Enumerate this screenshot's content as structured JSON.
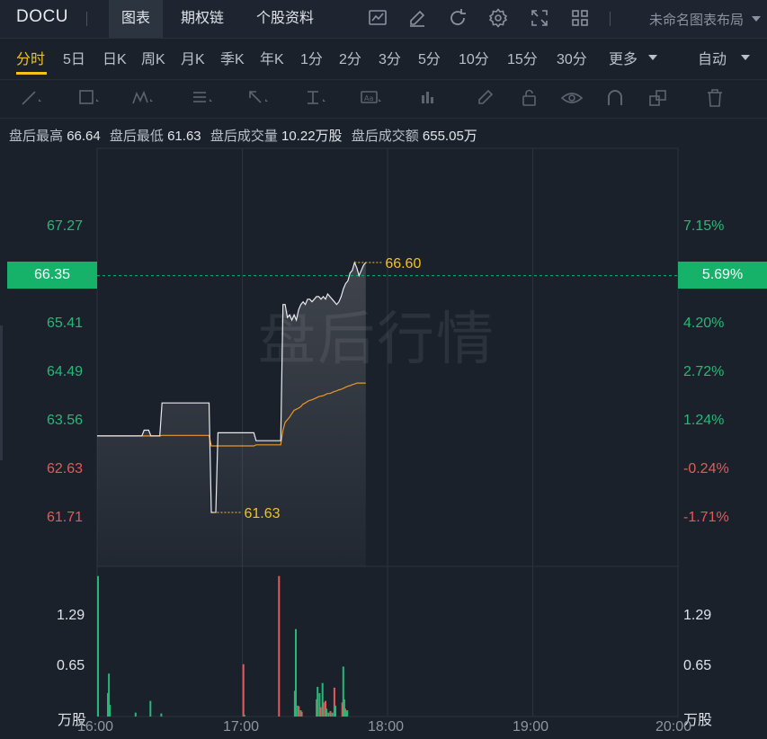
{
  "header": {
    "symbol": "DOCU",
    "tabs": [
      "图表",
      "期权链",
      "个股资料"
    ],
    "layout_name": "未命名图表布局",
    "icons": [
      "chart-indicator-icon",
      "draw-icon",
      "refresh-icon",
      "settings-icon",
      "fullscreen-icon",
      "grid-layout-icon"
    ]
  },
  "periods": [
    "分时",
    "5日",
    "日K",
    "周K",
    "月K",
    "季K",
    "年K",
    "1分",
    "2分",
    "3分",
    "5分",
    "10分",
    "15分",
    "30分",
    "更多"
  ],
  "period_mode": "自动",
  "tools": [
    "line-tool-icon",
    "rect-tool-icon",
    "pattern-tool-icon",
    "fib-tool-icon",
    "arrow-tool-icon",
    "measure-tool-icon",
    "text-tool-icon",
    "bar-tool-icon",
    "brush-icon",
    "lock-icon",
    "eye-icon",
    "magnet-icon",
    "layers-icon",
    "trash-icon"
  ],
  "stats": [
    {
      "label": "盘后最高",
      "value": "66.64"
    },
    {
      "label": "盘后最低",
      "value": "61.63"
    },
    {
      "label": "盘后成交量",
      "value": "10.22万股"
    },
    {
      "label": "盘后成交额",
      "value": "655.05万"
    }
  ],
  "watermark": "盘后行情",
  "colors": {
    "up": "#26b877",
    "down": "#e35a5a",
    "price_line": "#e8eaed",
    "avg_line": "#e8962e",
    "marker": "#f0c419",
    "badge": "#17b26a"
  },
  "chart_data": {
    "type": "line",
    "x_labels": [
      "16:00",
      "17:00",
      "18:00",
      "19:00",
      "20:00"
    ],
    "y_ticks": [
      "67.27",
      "65.41",
      "64.49",
      "63.56",
      "62.63",
      "61.71"
    ],
    "pct_ticks": [
      "7.15%",
      "4.20%",
      "2.72%",
      "1.24%",
      "-0.24%",
      "-1.71%"
    ],
    "current_price": "66.35",
    "current_pct": "5.69%",
    "high_marker": "66.60",
    "low_marker": "61.63",
    "volume_ticks": [
      "1.29",
      "0.65"
    ],
    "volume_unit": "万股",
    "price": [
      63.29,
      63.29,
      63.29,
      63.29,
      63.29,
      63.29,
      63.29,
      63.29,
      63.29,
      63.29,
      63.29,
      63.29,
      63.29,
      63.29,
      63.29,
      63.29,
      63.29,
      63.29,
      63.29,
      63.29,
      63.29,
      63.4,
      63.4,
      63.4,
      63.29,
      63.29,
      63.29,
      63.29,
      63.29,
      63.92,
      63.92,
      63.92,
      63.92,
      63.92,
      63.92,
      63.92,
      63.92,
      63.92,
      63.92,
      63.92,
      63.92,
      63.92,
      63.92,
      63.92,
      63.92,
      63.92,
      63.92,
      63.92,
      63.92,
      63.92,
      63.92,
      61.83,
      61.83,
      61.83,
      63.35,
      63.35,
      63.35,
      63.35,
      63.35,
      63.35,
      63.35,
      63.35,
      63.35,
      63.35,
      63.35,
      63.35,
      63.35,
      63.35,
      63.35,
      63.35,
      63.35,
      63.2,
      63.2,
      63.2,
      63.2,
      63.2,
      63.2,
      63.2,
      63.2,
      63.2,
      63.2,
      63.2,
      63.2,
      65.8,
      65.8,
      65.55,
      65.6,
      65.5,
      65.6,
      65.5,
      65.7,
      65.8,
      65.85,
      65.8,
      65.9,
      65.9,
      65.85,
      65.9,
      65.95,
      65.95,
      65.9,
      65.95,
      65.9,
      66.0,
      65.95,
      65.9,
      65.85,
      65.8,
      65.85,
      65.95,
      66.1,
      66.2,
      66.25,
      66.4,
      66.45,
      66.6,
      66.5,
      66.35,
      66.45,
      66.55,
      66.6
    ],
    "avg": [
      63.29,
      63.29,
      63.29,
      63.29,
      63.29,
      63.29,
      63.29,
      63.29,
      63.29,
      63.29,
      63.29,
      63.29,
      63.29,
      63.29,
      63.29,
      63.29,
      63.29,
      63.29,
      63.29,
      63.29,
      63.29,
      63.29,
      63.29,
      63.29,
      63.29,
      63.29,
      63.29,
      63.29,
      63.29,
      63.3,
      63.3,
      63.3,
      63.3,
      63.3,
      63.3,
      63.3,
      63.3,
      63.3,
      63.3,
      63.3,
      63.3,
      63.3,
      63.3,
      63.3,
      63.3,
      63.3,
      63.3,
      63.3,
      63.3,
      63.3,
      63.3,
      63.1,
      63.1,
      63.1,
      63.1,
      63.1,
      63.1,
      63.1,
      63.1,
      63.1,
      63.1,
      63.1,
      63.1,
      63.1,
      63.1,
      63.1,
      63.1,
      63.1,
      63.1,
      63.1,
      63.1,
      63.12,
      63.12,
      63.12,
      63.12,
      63.12,
      63.12,
      63.12,
      63.12,
      63.12,
      63.12,
      63.12,
      63.12,
      63.4,
      63.55,
      63.6,
      63.65,
      63.72,
      63.78,
      63.8,
      63.82,
      63.85,
      63.9,
      63.92,
      63.95,
      63.97,
      63.98,
      64.0,
      64.02,
      64.04,
      64.05,
      64.06,
      64.08,
      64.1,
      64.1,
      64.12,
      64.14,
      64.15,
      64.17,
      64.18,
      64.2,
      64.22,
      64.24,
      64.25,
      64.27,
      64.28,
      64.3,
      64.3,
      64.3,
      64.3,
      64.3
    ],
    "volume": [
      1.8,
      0,
      0,
      0,
      0,
      0,
      0,
      0,
      0,
      0,
      0,
      0.4,
      0.55,
      0.15,
      0,
      0,
      0,
      0,
      0,
      0,
      0,
      0,
      0,
      0,
      0,
      0,
      0,
      0,
      0,
      0,
      0,
      0,
      0,
      0,
      0,
      0,
      0,
      0,
      0.05,
      0,
      0,
      0,
      0,
      0,
      0,
      0,
      0,
      0,
      0,
      0.1,
      0.02,
      0.03,
      0.05,
      0,
      0,
      0,
      0,
      0,
      0,
      0,
      0,
      0,
      0,
      0,
      0,
      0,
      0,
      0,
      0,
      0.05,
      0.03,
      0.03,
      0,
      0,
      0,
      0,
      0,
      0,
      0,
      0,
      0,
      0,
      0,
      0.08,
      0.06,
      0.05,
      0,
      0,
      0,
      0.01,
      0.05,
      0.03,
      0.02,
      0.01,
      0.03,
      0.02,
      0,
      0,
      0.02,
      0.03,
      0.04,
      0,
      0.03,
      0.04,
      0.02,
      0.05,
      0.06,
      0.1,
      0.04,
      0.03,
      0.02,
      0.03,
      0.05,
      0.03,
      0.02,
      0.04,
      0.03,
      0.04
    ],
    "volume_up": [
      true,
      true,
      true,
      true,
      true,
      true,
      true,
      true,
      true,
      true,
      true,
      true,
      true,
      true,
      true,
      true,
      true,
      true,
      true,
      true,
      true,
      true,
      true,
      true,
      true,
      true,
      true,
      true,
      true,
      true,
      true,
      true,
      true,
      true,
      true,
      true,
      true,
      true,
      true,
      true,
      true,
      true,
      true,
      true,
      true,
      true,
      true,
      true,
      true,
      true,
      true,
      true,
      true,
      true,
      true,
      true,
      true,
      true,
      true,
      true,
      true,
      true,
      true,
      true,
      true,
      true,
      true,
      true,
      true,
      true,
      true,
      true,
      true,
      true,
      true,
      true,
      true,
      true,
      true,
      true,
      true,
      true,
      true,
      true,
      true,
      true,
      true,
      true,
      true,
      true,
      true,
      true,
      true,
      true,
      true,
      true,
      true,
      true,
      true,
      true,
      true,
      true,
      true,
      true,
      true,
      true,
      true,
      true,
      true,
      true,
      true,
      true,
      true,
      true,
      true,
      true,
      true,
      true,
      true,
      true,
      true,
      true,
      true,
      true
    ],
    "volume_bars": [
      {
        "t": 0,
        "v": 1.8,
        "up": true
      },
      {
        "t": 10,
        "v": 0.3,
        "up": true
      },
      {
        "t": 11,
        "v": 0.55,
        "up": true
      },
      {
        "t": 12,
        "v": 0.15,
        "up": true
      },
      {
        "t": 38,
        "v": 0.05,
        "up": true
      },
      {
        "t": 53,
        "v": 0.2,
        "up": true
      },
      {
        "t": 64,
        "v": 0.04,
        "up": true
      },
      {
        "t": 147,
        "v": 0.67,
        "up": false
      },
      {
        "t": 148,
        "v": 0.02,
        "up": true
      },
      {
        "t": 183,
        "v": 1.8,
        "up": false
      },
      {
        "t": 199,
        "v": 0.33,
        "up": true
      },
      {
        "t": 200,
        "v": 1.12,
        "up": true
      },
      {
        "t": 202,
        "v": 0.14,
        "up": true
      },
      {
        "t": 203,
        "v": 0.13,
        "up": false
      },
      {
        "t": 205,
        "v": 0.08,
        "up": true
      },
      {
        "t": 206,
        "v": 0.06,
        "up": false
      },
      {
        "t": 221,
        "v": 0.22,
        "up": false
      },
      {
        "t": 222,
        "v": 0.38,
        "up": true
      },
      {
        "t": 224,
        "v": 0.3,
        "up": true
      },
      {
        "t": 225,
        "v": 0.12,
        "up": false
      },
      {
        "t": 227,
        "v": 0.43,
        "up": true
      },
      {
        "t": 228,
        "v": 0.18,
        "up": false
      },
      {
        "t": 230,
        "v": 0.2,
        "up": false
      },
      {
        "t": 231,
        "v": 0.1,
        "up": true
      },
      {
        "t": 233,
        "v": 0.05,
        "up": true
      },
      {
        "t": 235,
        "v": 0.07,
        "up": false
      },
      {
        "t": 237,
        "v": 0.05,
        "up": true
      },
      {
        "t": 239,
        "v": 0.37,
        "up": false
      },
      {
        "t": 240,
        "v": 0.14,
        "up": true
      },
      {
        "t": 247,
        "v": 0.18,
        "up": false
      },
      {
        "t": 248,
        "v": 0.64,
        "up": true
      },
      {
        "t": 249,
        "v": 0.22,
        "up": true
      },
      {
        "t": 250,
        "v": 0.1,
        "up": false
      },
      {
        "t": 251,
        "v": 0.07,
        "up": true
      },
      {
        "t": 252,
        "v": 0.08,
        "up": true
      }
    ]
  }
}
